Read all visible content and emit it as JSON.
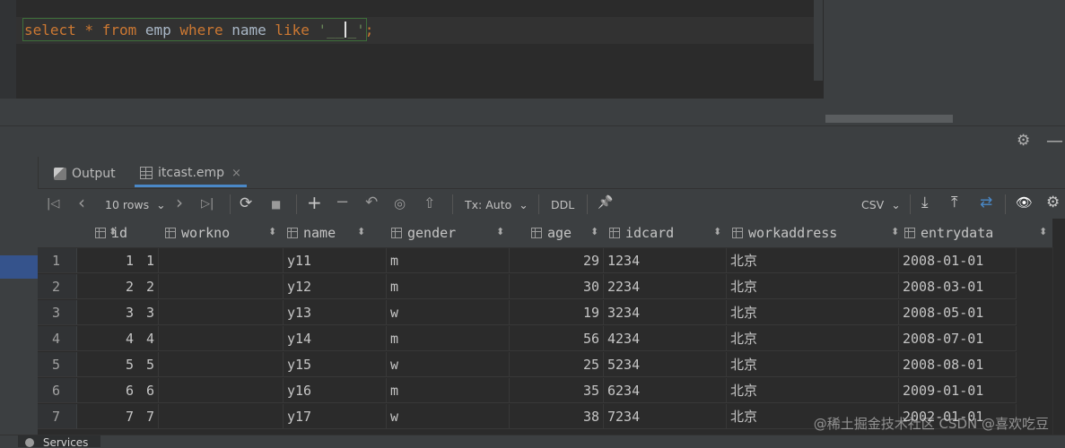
{
  "editor": {
    "sql_tokens": [
      {
        "text": "select",
        "kind": "kw"
      },
      {
        "text": " * ",
        "kind": "kw"
      },
      {
        "text": "from",
        "kind": "kw"
      },
      {
        "text": " emp ",
        "kind": "id"
      },
      {
        "text": "where",
        "kind": "kw"
      },
      {
        "text": " name ",
        "kind": "id"
      },
      {
        "text": "like",
        "kind": "kw"
      },
      {
        "text": " '",
        "kind": "str"
      },
      {
        "text": "__",
        "kind": "str"
      },
      {
        "text": "_'",
        "kind": "str"
      },
      {
        "text": ";",
        "kind": "kw"
      }
    ]
  },
  "tabs": {
    "output": "Output",
    "itcast": "itcast.emp",
    "close": "×"
  },
  "toolbar": {
    "rows": "10 rows",
    "tx": "Tx: Auto",
    "ddl": "DDL",
    "csv": "CSV"
  },
  "icons": {
    "gear": "⚙",
    "first": "|◁",
    "prev": "‹",
    "next": "›",
    "last": "▷|",
    "refresh": "⟳",
    "stop": "■",
    "add": "+",
    "remove": "−",
    "revert": "↶",
    "preview": "◎",
    "submit": "⇧",
    "pin": "📌",
    "download": "⤓",
    "upload": "⤒",
    "compare": "⇄",
    "eye": "👁",
    "dropdown": "⌄",
    "sort": "⬍"
  },
  "columns": [
    "id",
    "workno",
    "name",
    "gender",
    "age",
    "idcard",
    "workaddress",
    "entrydata"
  ],
  "rows": [
    {
      "n": "1",
      "id": "1",
      "workno": "1",
      "name": "y11",
      "gender": "m",
      "age": "29",
      "idcard": "1234",
      "workaddress": "北京",
      "entrydata": "2008-01-01"
    },
    {
      "n": "2",
      "id": "2",
      "workno": "2",
      "name": "y12",
      "gender": "m",
      "age": "30",
      "idcard": "2234",
      "workaddress": "北京",
      "entrydata": "2008-03-01"
    },
    {
      "n": "3",
      "id": "3",
      "workno": "3",
      "name": "y13",
      "gender": "w",
      "age": "19",
      "idcard": "3234",
      "workaddress": "北京",
      "entrydata": "2008-05-01"
    },
    {
      "n": "4",
      "id": "4",
      "workno": "4",
      "name": "y14",
      "gender": "m",
      "age": "56",
      "idcard": "4234",
      "workaddress": "北京",
      "entrydata": "2008-07-01"
    },
    {
      "n": "5",
      "id": "5",
      "workno": "5",
      "name": "y15",
      "gender": "w",
      "age": "25",
      "idcard": "5234",
      "workaddress": "北京",
      "entrydata": "2008-08-01"
    },
    {
      "n": "6",
      "id": "6",
      "workno": "6",
      "name": "y16",
      "gender": "m",
      "age": "35",
      "idcard": "6234",
      "workaddress": "北京",
      "entrydata": "2009-01-01"
    },
    {
      "n": "7",
      "id": "7",
      "workno": "7",
      "name": "y17",
      "gender": "w",
      "age": "38",
      "idcard": "7234",
      "workaddress": "北京",
      "entrydata": "2002-01-01"
    }
  ],
  "bottom": {
    "services": "Services"
  },
  "watermark": "@稀土掘金技术社区 CSDN @喜欢吃豆",
  "colors": {
    "keyword": "#cc7832",
    "string": "#6a8759",
    "accent": "#4a88c7"
  }
}
